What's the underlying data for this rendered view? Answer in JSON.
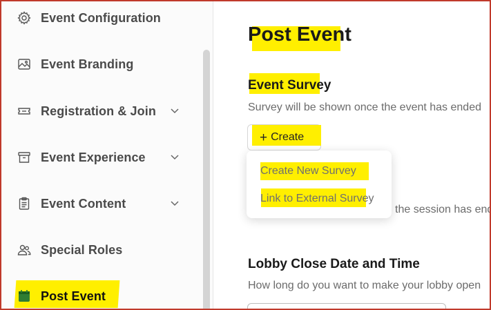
{
  "sidebar": {
    "items": [
      {
        "label": "Event Configuration",
        "icon": "gear-icon",
        "has_chevron": false
      },
      {
        "label": "Event Branding",
        "icon": "image-icon",
        "has_chevron": false
      },
      {
        "label": "Registration & Join",
        "icon": "ticket-icon",
        "has_chevron": true
      },
      {
        "label": "Event Experience",
        "icon": "archive-box-icon",
        "has_chevron": true
      },
      {
        "label": "Event Content",
        "icon": "clipboard-icon",
        "has_chevron": true
      },
      {
        "label": "Special Roles",
        "icon": "people-icon",
        "has_chevron": false
      },
      {
        "label": "Post Event",
        "icon": "calendar-icon",
        "has_chevron": false,
        "active": true
      }
    ]
  },
  "main": {
    "title": "Post Event",
    "survey": {
      "title": "Event Survey",
      "description": "Survey will be shown once the event has ended",
      "create_label": "Create",
      "menu": [
        "Create New Survey",
        "Link to External Survey"
      ],
      "partial_text": "the session has ended"
    },
    "lobby": {
      "title": "Lobby Close Date and Time",
      "description": "How long do you want to make your lobby open"
    }
  },
  "colors": {
    "highlight": "#ffef00",
    "active_icon": "#2e7d32",
    "frame_border": "#c0392b"
  }
}
